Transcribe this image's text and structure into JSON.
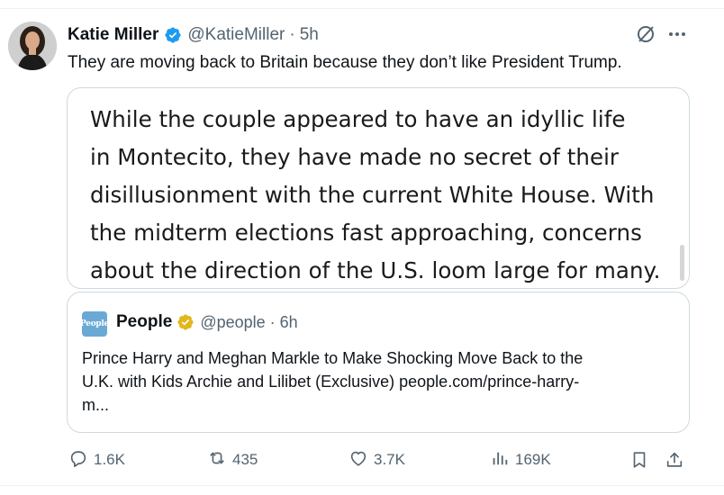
{
  "post": {
    "author_name": "Katie Miller",
    "handle": "@KatieMiller",
    "separator": "·",
    "time": "5h",
    "text": "They are moving back to Britain because they don’t like President Trump.",
    "verified_color": "#1d9bf0",
    "image_text_lines": [
      "While the couple appeared to have an idyllic life",
      "in Montecito, they have made no secret of their",
      "disillusionment with the current White House. With",
      "the midterm elections fast approaching, concerns",
      "about the direction of the U.S. loom large for many."
    ]
  },
  "quote": {
    "logo_text": "People",
    "name": "People",
    "handle": "@people",
    "separator": "·",
    "time": "6h",
    "verified_color": "#e2b719",
    "text_lines": [
      "Prince Harry and Meghan Markle to Make Shocking Move Back to the",
      "U.K. with Kids Archie and Lilibet (Exclusive) people.com/prince-harry-",
      "m..."
    ]
  },
  "actions": {
    "replies": "1.6K",
    "reposts": "435",
    "likes": "3.7K",
    "views": "169K"
  },
  "icons": {
    "grok": "grok-icon",
    "more": "more-icon",
    "reply": "reply-icon",
    "repost": "repost-icon",
    "like": "heart-icon",
    "views": "views-icon",
    "bookmark": "bookmark-icon",
    "share": "share-icon"
  }
}
